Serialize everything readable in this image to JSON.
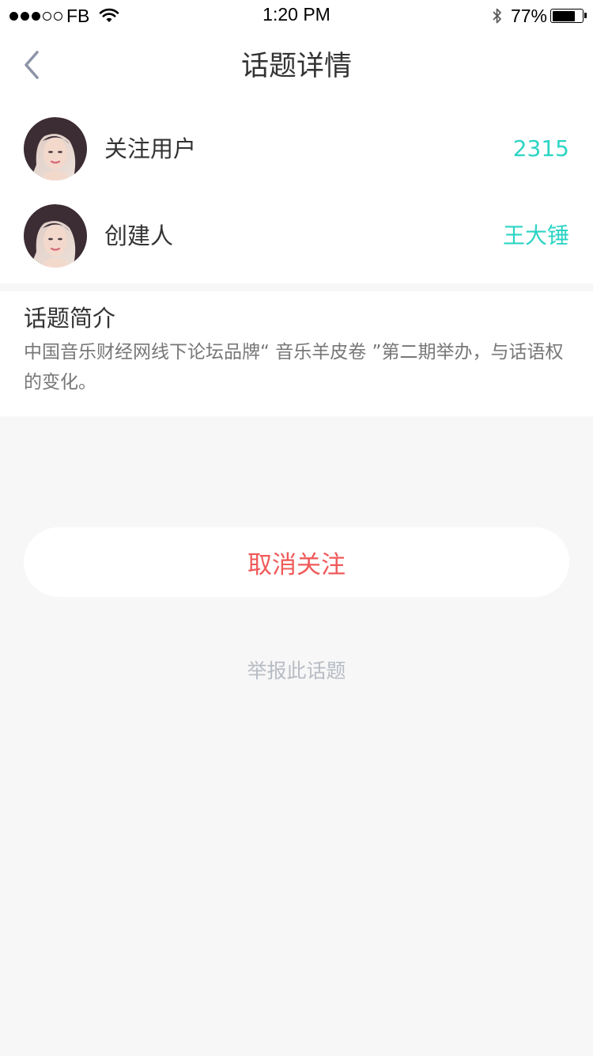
{
  "status_bar": {
    "carrier": "FB",
    "time": "1:20 PM",
    "battery_percent": "77%",
    "battery_level": 0.77,
    "signal_bars_filled": 3,
    "signal_bars_total": 5,
    "icons": [
      "signal-dots",
      "wifi-icon",
      "bluetooth-icon",
      "battery-icon"
    ]
  },
  "nav": {
    "title": "话题详情",
    "back_icon": "chevron-left-icon"
  },
  "info": {
    "followers_label": "关注用户",
    "followers_count": "2315",
    "creator_label": "创建人",
    "creator_name": "王大锤"
  },
  "intro": {
    "title": "话题简介",
    "body": "中国音乐财经网线下论坛品牌“ 音乐羊皮卷 ”第二期举办，与话语权的变化。"
  },
  "actions": {
    "unfollow_label": "取消关注",
    "report_label": "举报此话题"
  },
  "colors": {
    "accent_teal": "#2dd4c4",
    "danger_red": "#f05a5a",
    "page_bg": "#f7f7f7",
    "muted_text": "#b8bcc4"
  }
}
